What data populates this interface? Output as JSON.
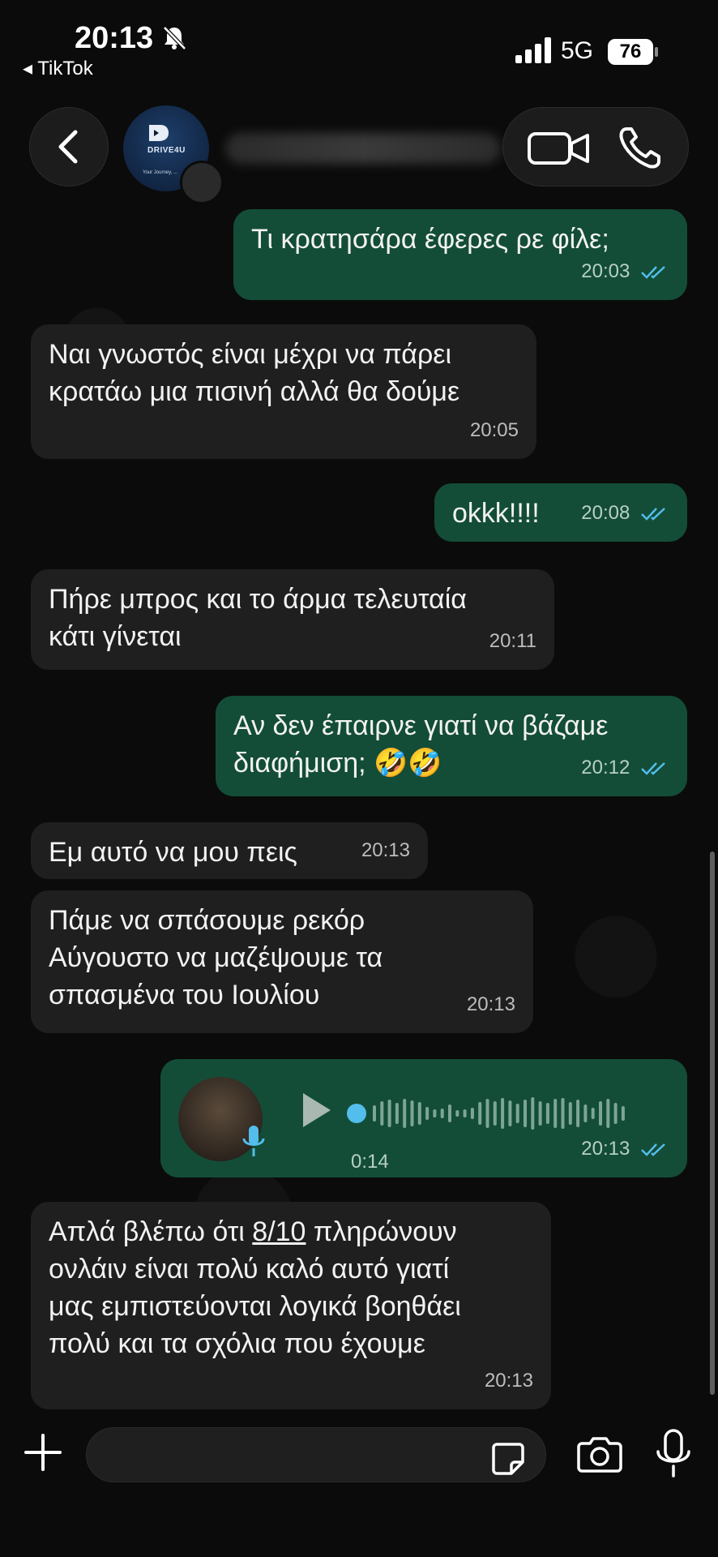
{
  "status_bar": {
    "time": "20:13",
    "back_app": "◂ TikTok",
    "network": "5G",
    "battery": "76"
  },
  "header": {
    "avatar_brand": "DRIVE4U",
    "avatar_tagline": "Your Journey, ..."
  },
  "messages": [
    {
      "dir": "out",
      "text": "Τι κρατησάρα έφερες ρε φίλε;",
      "time": "20:03",
      "read": true
    },
    {
      "dir": "in",
      "lines": [
        "Ναι γνωστός είναι μέχρι να πάρει",
        "κρατάω μια πισινή αλλά θα δούμε"
      ],
      "time": "20:05"
    },
    {
      "dir": "out",
      "text": "okkk!!!!",
      "time": "20:08",
      "read": true
    },
    {
      "dir": "in",
      "lines": [
        "Πήρε μπρος και το άρμα τελευταία",
        "κάτι γίνεται"
      ],
      "time": "20:11"
    },
    {
      "dir": "out",
      "lines": [
        "Αν δεν έπαιρνε γιατί να βάζαμε",
        "διαφήμιση; 🤣🤣"
      ],
      "time": "20:12",
      "read": true
    },
    {
      "dir": "in",
      "text": "Εμ αυτό να μου πεις",
      "time": "20:13"
    },
    {
      "dir": "in",
      "lines": [
        "Πάμε να σπάσουμε ρεκόρ",
        "Αύγουστο να μαζέψουμε τα",
        "σπασμένα του Ιουλίου"
      ],
      "time": "20:13"
    },
    {
      "dir": "out",
      "type": "voice",
      "duration": "0:14",
      "time": "20:13",
      "read": true,
      "progress": 0
    },
    {
      "dir": "in",
      "lines": [
        "Απλά βλέπω ότι",
        "8/10",
        "πληρώνουν",
        "ονλάιν είναι πολύ καλό αυτό γιατί",
        "μας εμπιστεύονται λογικά βοηθάει",
        "πολύ και τα σχόλια που έχουμε"
      ],
      "time": "20:13"
    }
  ],
  "input": {
    "placeholder": ""
  },
  "icons": {
    "back": "chevron-left-icon",
    "video": "video-camera-icon",
    "call": "phone-icon",
    "add": "plus-icon",
    "sticker": "sticker-icon",
    "camera": "camera-icon",
    "mic": "microphone-icon",
    "silent": "bell-slash-icon"
  },
  "colors": {
    "outgoing_bubble": "#134d37",
    "incoming_bubble": "#1f1f1f",
    "read_ticks": "#53bdeb"
  }
}
